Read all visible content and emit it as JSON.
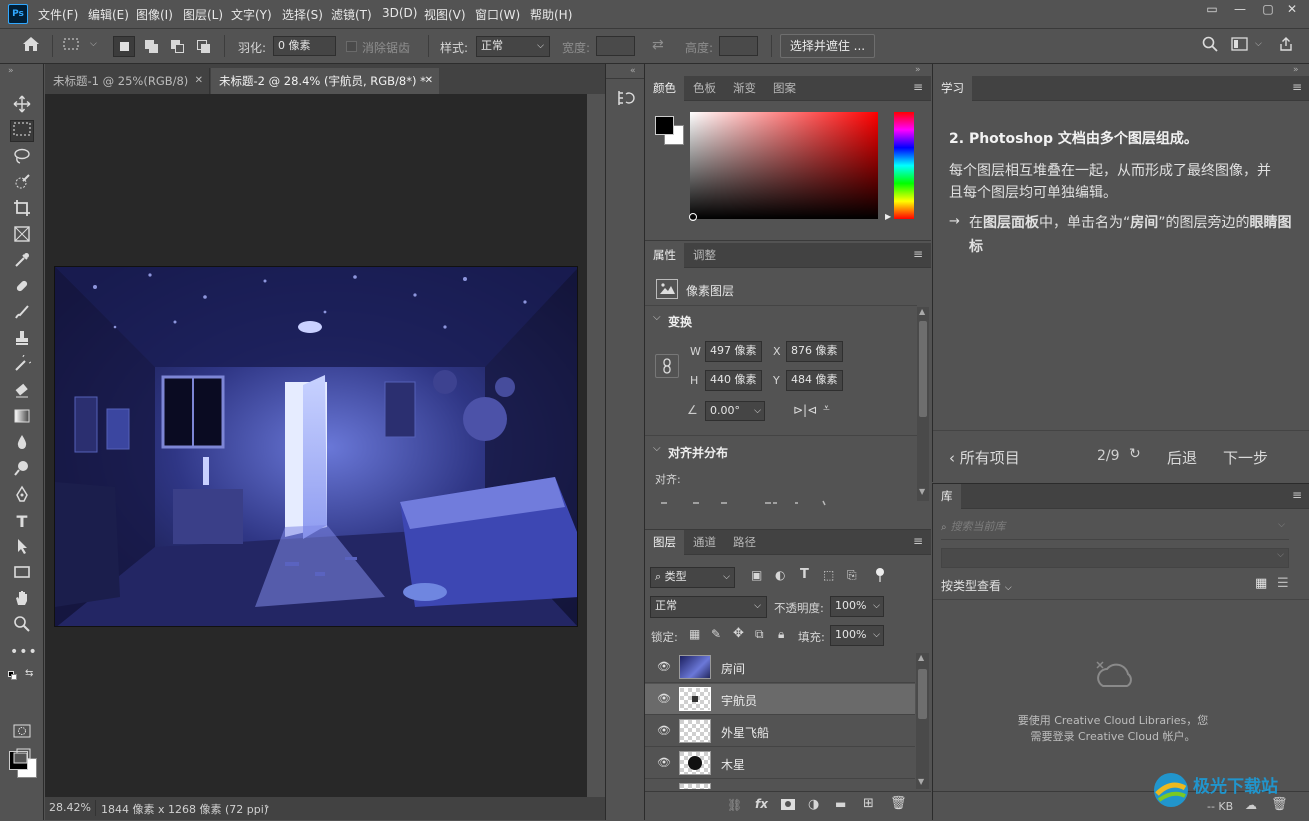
{
  "app": {
    "logo": "Ps"
  },
  "menu": [
    "文件(F)",
    "编辑(E)",
    "图像(I)",
    "图层(L)",
    "文字(Y)",
    "选择(S)",
    "滤镜(T)",
    "3D(D)",
    "视图(V)",
    "窗口(W)",
    "帮助(H)"
  ],
  "window_controls": [
    "▭",
    "—",
    "▢",
    "✕"
  ],
  "options": {
    "feather_label": "羽化:",
    "feather_value": "0 像素",
    "antialias_label": "消除锯齿",
    "style_label": "样式:",
    "style_value": "正常",
    "width_label": "宽度:",
    "height_label": "高度:",
    "select_mask_button": "选择并遮住 ..."
  },
  "doc_tabs": [
    {
      "label": "未标题-1 @ 25%(RGB/8)",
      "active": false
    },
    {
      "label": "未标题-2 @ 28.4% (宇航员, RGB/8*) *",
      "active": true
    }
  ],
  "status": {
    "zoom": "28.42%",
    "doc_info": "1844 像素 x 1268 像素 (72 ppi)",
    "arrow": "›"
  },
  "color_panel": {
    "tabs": [
      "颜色",
      "色板",
      "渐变",
      "图案"
    ]
  },
  "properties_panel": {
    "tabs": [
      "属性",
      "调整"
    ],
    "layer_type": "像素图层",
    "transform_title": "变换",
    "w_label": "W",
    "w_value": "497 像素",
    "h_label": "H",
    "h_value": "440 像素",
    "x_label": "X",
    "x_value": "876 像素",
    "y_label": "Y",
    "y_value": "484 像素",
    "angle_value": "0.00°",
    "align_title": "对齐并分布",
    "align_label": "对齐:"
  },
  "layers_panel": {
    "tabs": [
      "图层",
      "通道",
      "路径"
    ],
    "filter_kind": "类型",
    "blend_mode": "正常",
    "opacity_label": "不透明度:",
    "opacity_value": "100%",
    "lock_label": "锁定:",
    "fill_label": "填充:",
    "fill_value": "100%",
    "layers": [
      {
        "name": "房间",
        "selected": false
      },
      {
        "name": "宇航员",
        "selected": true
      },
      {
        "name": "外星飞船",
        "selected": false
      },
      {
        "name": "木星",
        "selected": false
      }
    ],
    "bottom_icons": [
      "link-icon",
      "fx-icon",
      "mask-icon",
      "adjustment-icon",
      "folder-icon",
      "new-layer-icon",
      "trash-icon"
    ]
  },
  "learn_panel": {
    "tab": "学习",
    "step_num": "2.",
    "heading": "Photoshop 文档由多个图层组成。",
    "body": "每个图层相互堆叠在一起，从而形成了最终图像，并且每个图层均可单独编辑。",
    "instruction_pre": "在",
    "instruction_b1": "图层面板",
    "instruction_mid": "中，单击名为“",
    "instruction_b2": "房间",
    "instruction_post": "”的图层旁边的",
    "instruction_b3": "眼睛图标",
    "back_all": "所有项目",
    "progress": "2/9",
    "prev": "后退",
    "next": "下一步"
  },
  "library_panel": {
    "tab": "库",
    "search_placeholder": "搜索当前库",
    "view_by": "按类型查看",
    "message_line1": "要使用 Creative Cloud Libraries，您",
    "message_line2": "需要登录 Creative Cloud 帐户。",
    "kb": "-- KB"
  },
  "watermark": "极光下载站",
  "colors": {
    "foreground": "#000000",
    "background": "#ffffff",
    "accent_blue": "#31a8ff"
  }
}
